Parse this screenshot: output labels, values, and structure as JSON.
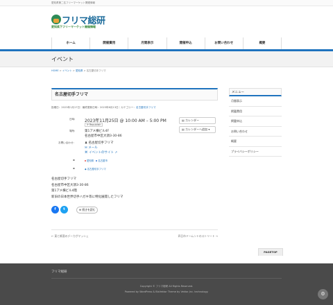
{
  "site": {
    "tagline": "愛知県第二名フリーマーケット関連情報",
    "logo_title": "フリマ総研",
    "logo_subtitle": "愛知県下フリーマーケット開催情報"
  },
  "nav": [
    "ホーム",
    "開催費用",
    "月間表示",
    "開催申込",
    "お問い合わせ",
    "概要"
  ],
  "page_header": "イベント",
  "breadcrumb": {
    "home": "HOME",
    "sep1": " > ",
    "events": "イベント",
    "sep2": " > ",
    "category": "愛知県",
    "sep3": " > ",
    "current": "名古屋切手フリマ"
  },
  "post": {
    "title": "名古屋切手フリマ",
    "meta_prefix": "投稿日：2023年1月17日｜最終更新日時：2023年6月13日｜カテゴリー：",
    "meta_category": "名古屋切手フリマ"
  },
  "event": {
    "date_label": "日時:",
    "date_value": "2023年11月25日 @ 10:00 AM – 5:00 PM",
    "republish": "Republish",
    "place_label": "場所:",
    "place_line1": "第1アメ横ビル4F",
    "place_line2": "名古屋市中区大須3-30-86",
    "contact_label": "お問い合わせ:",
    "contact_name": "名古屋切手フリマ",
    "contact_mail": "メール",
    "contact_site": "イベントのサイト",
    "cats": [
      "愛知県",
      "名古屋市"
    ],
    "tag": "名古屋切手フリマ",
    "calendar_btn": "カレンダー",
    "calendar_add_btn": "カレンダーへ追加"
  },
  "body": [
    "名古屋切手フリマ",
    "名古屋市中区大須3-30-86",
    "第1アメ横ビル4階",
    "新旧の日本世界切手ハガキ等に特化展開したフリマ"
  ],
  "share": {
    "facebook": "f",
    "twitter": "t",
    "bookmark": "続きを読む"
  },
  "pagination": {
    "prev": "← 東と綿湯のデーカがマッシェ",
    "next": "四日市ドームントのストリート →"
  },
  "sidebar": {
    "heading": "メニュー",
    "items": [
      "月間表示",
      "掲載費用",
      "掲載申込",
      "お問い合わせ",
      "概要",
      "プライバシーポリシー"
    ]
  },
  "pagetop": "PAGETOP",
  "footer": {
    "title": "フリマ総研",
    "copyright": "Copyright © フリマ総研 All Rights Reserved.",
    "powered": "Powered by WordPress & BizVektor Theme by Vektor,Inc. technology."
  },
  "colors": {
    "accent": "#1e73be",
    "footer_bg": "#4a4a4a"
  }
}
